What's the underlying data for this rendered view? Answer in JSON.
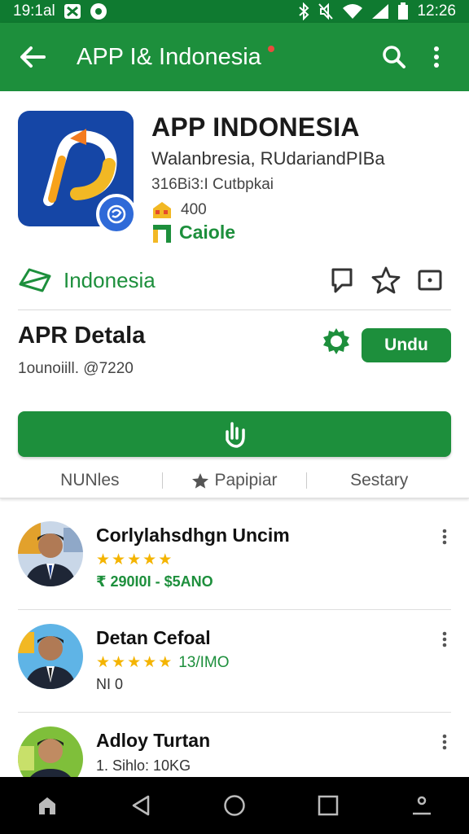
{
  "status_bar": {
    "time_left": "19:1al",
    "time_right": "12:26",
    "icons_left": [
      "notification-icon",
      "sync-icon"
    ],
    "icons_right": [
      "bluetooth-icon",
      "mute-icon",
      "wifi-icon",
      "signal-icon",
      "battery-icon"
    ]
  },
  "app_bar": {
    "title": "APP I& Indonesia",
    "back_icon": "arrow-left-icon",
    "actions": [
      "search-icon",
      "more-vert-icon"
    ]
  },
  "app": {
    "name": "APP INDONESIA",
    "developer": "Walanbresia, RUdariandPIBa",
    "subline": "316Bi3:I Cutbpkai",
    "rating_count": "400",
    "category": "Caiole"
  },
  "country_row": {
    "label": "Indonesia",
    "actions": [
      "comment-icon",
      "star-outline-icon",
      "share-icon"
    ]
  },
  "detail": {
    "title": "APR Detala",
    "subtitle": "1ounoiill. @7220",
    "button_label": "Undu"
  },
  "tabs": [
    {
      "label": "NUNles"
    },
    {
      "label": "Papipiar",
      "icon": "star-icon"
    },
    {
      "label": "Sestary"
    }
  ],
  "list": [
    {
      "name": "Corlylahsdhgn Uncim",
      "rating": 4.5,
      "meta": "₹ 290I0I - $5ANO",
      "meta2": ""
    },
    {
      "name": "Detan Cefoal",
      "rating": 4.5,
      "meta": "13/IMO",
      "meta2": "NI 0"
    },
    {
      "name": "Adloy Turtan",
      "rating": 0,
      "meta": "1. Sihlo: 10KG",
      "meta2": ""
    }
  ],
  "nav_bar": [
    "home-icon",
    "back-triangle-icon",
    "circle-home-icon",
    "recents-icon",
    "profile-icon"
  ],
  "colors": {
    "primary": "#1d8f3c",
    "status_bar": "#0f7a30",
    "star": "#f4b400",
    "icon_bg": "#1546a6"
  }
}
